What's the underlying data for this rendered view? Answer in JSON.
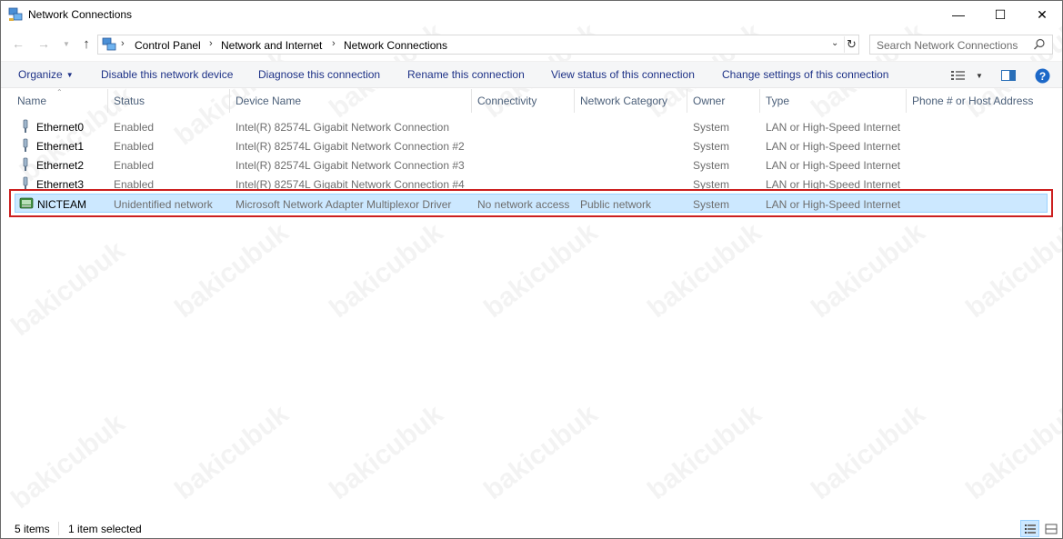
{
  "window": {
    "title": "Network Connections",
    "buttons": {
      "minimize": "—",
      "maximize": "☐",
      "close": "✕"
    }
  },
  "address": {
    "breadcrumbs": [
      "Control Panel",
      "Network and Internet",
      "Network Connections"
    ],
    "separator": "›",
    "search_placeholder": "Search Network Connections"
  },
  "toolbar": {
    "organize": "Organize",
    "commands": [
      "Disable this network device",
      "Diagnose this connection",
      "Rename this connection",
      "View status of this connection",
      "Change settings of this connection"
    ]
  },
  "columns": [
    "Name",
    "Status",
    "Device Name",
    "Connectivity",
    "Network Category",
    "Owner",
    "Type",
    "Phone # or Host Address"
  ],
  "rows": [
    {
      "name": "Ethernet0",
      "status": "Enabled",
      "device": "Intel(R) 82574L Gigabit Network Connection",
      "connectivity": "",
      "category": "",
      "owner": "System",
      "type": "LAN or High-Speed Internet",
      "phone": "",
      "icon": "ethernet-adapter-icon",
      "selected": false
    },
    {
      "name": "Ethernet1",
      "status": "Enabled",
      "device": "Intel(R) 82574L Gigabit Network Connection #2",
      "connectivity": "",
      "category": "",
      "owner": "System",
      "type": "LAN or High-Speed Internet",
      "phone": "",
      "icon": "ethernet-adapter-icon",
      "selected": false
    },
    {
      "name": "Ethernet2",
      "status": "Enabled",
      "device": "Intel(R) 82574L Gigabit Network Connection #3",
      "connectivity": "",
      "category": "",
      "owner": "System",
      "type": "LAN or High-Speed Internet",
      "phone": "",
      "icon": "ethernet-adapter-icon",
      "selected": false
    },
    {
      "name": "Ethernet3",
      "status": "Enabled",
      "device": "Intel(R) 82574L Gigabit Network Connection #4",
      "connectivity": "",
      "category": "",
      "owner": "System",
      "type": "LAN or High-Speed Internet",
      "phone": "",
      "icon": "ethernet-adapter-icon",
      "selected": false
    },
    {
      "name": "NICTEAM",
      "status": "Unidentified network",
      "device": "Microsoft Network Adapter Multiplexor Driver",
      "connectivity": "No network access",
      "category": "Public network",
      "owner": "System",
      "type": "LAN or High-Speed Internet",
      "phone": "",
      "icon": "network-team-icon",
      "selected": true
    }
  ],
  "status": {
    "count": "5 items",
    "selection": "1 item selected"
  },
  "watermark": "bakicubuk",
  "colors": {
    "selection_bg": "#cce8ff",
    "selection_border": "#99d1ff",
    "highlight_box": "#cc1f1f",
    "command_text": "#1e3287",
    "header_text": "#4c607a"
  }
}
